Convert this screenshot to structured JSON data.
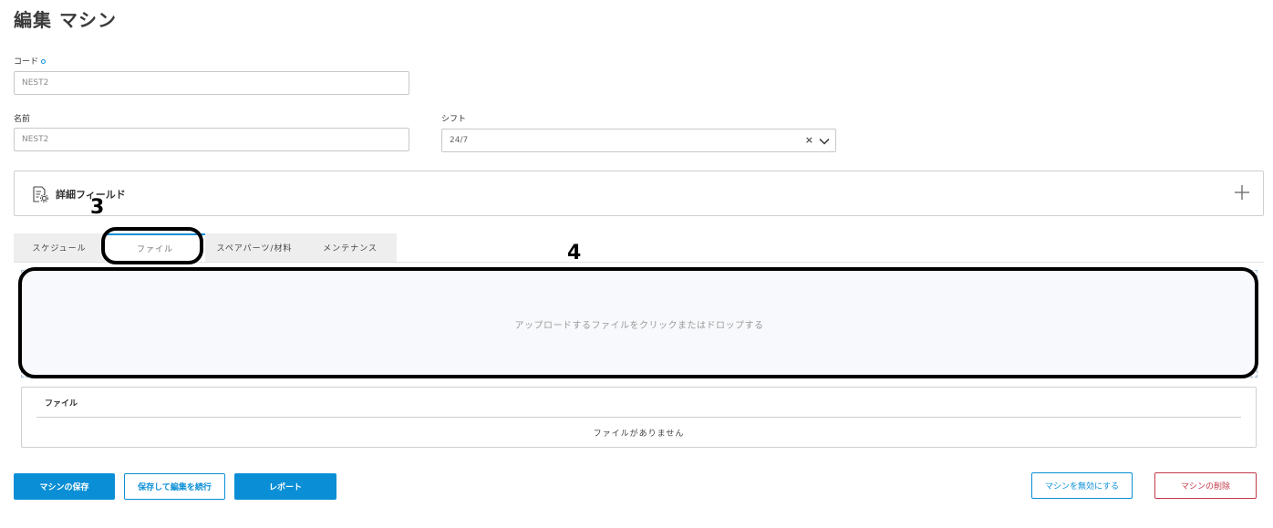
{
  "page": {
    "title": "編集 マシン"
  },
  "form": {
    "code": {
      "label": "コード",
      "value": "NEST2"
    },
    "name": {
      "label": "名前",
      "value": "NEST2"
    },
    "shift": {
      "label": "シフト",
      "value": "24/7",
      "clear_glyph": "×"
    }
  },
  "details": {
    "label": "詳細フィールド"
  },
  "tabs": [
    {
      "label": "スケジュール"
    },
    {
      "label": "ファイル"
    },
    {
      "label": "スペアパーツ/材料"
    },
    {
      "label": "メンテナンス"
    }
  ],
  "active_tab": "ファイル",
  "upload": {
    "prompt": "アップロードするファイルをクリックまたはドロップする"
  },
  "files_table": {
    "header": "ファイル",
    "empty_message": "ファイルがありません"
  },
  "actions": {
    "save": "マシンの保存",
    "save_continue": "保存して編集を続行",
    "report": "レポート",
    "disable": "マシンを無効にする",
    "delete": "マシンの削除"
  },
  "annotations": {
    "tab_marker": "3",
    "dropzone_marker": "4"
  },
  "colors": {
    "accent": "#0a8fd6",
    "danger": "#c23a4a"
  }
}
